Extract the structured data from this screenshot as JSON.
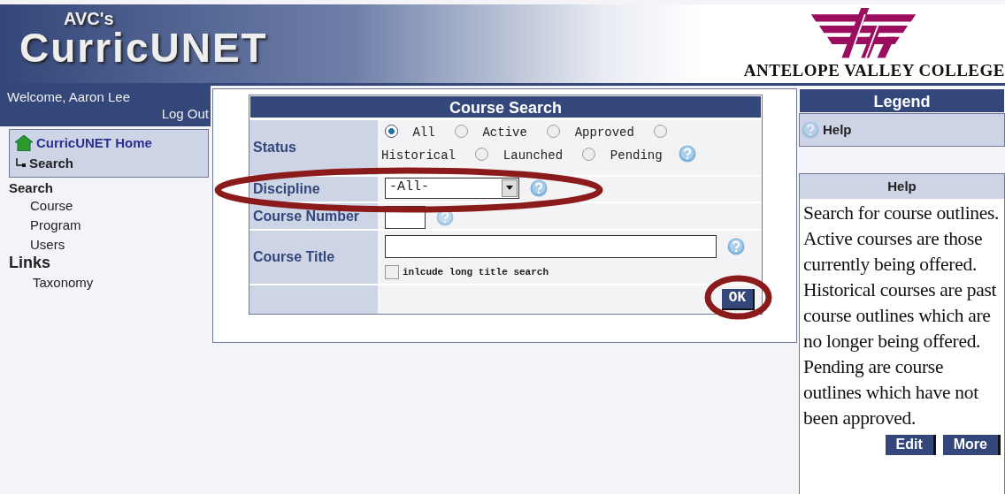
{
  "header": {
    "prefix": "AVC's",
    "title": "CurricUNET",
    "college": "ANTELOPE VALLEY COLLEGE"
  },
  "user": {
    "welcome": "Welcome, Aaron Lee",
    "logout": "Log Out"
  },
  "nav_box": {
    "home": "CurricUNET Home",
    "current": "Search"
  },
  "sidebar": [
    {
      "heading": "Search",
      "items": [
        "Course",
        "Program",
        "Users"
      ]
    },
    {
      "heading": "Links",
      "items": [
        "Taxonomy"
      ]
    }
  ],
  "form": {
    "title": "Course Search",
    "status": {
      "label": "Status",
      "circled": false,
      "options": [
        {
          "label": "All",
          "selected": true
        },
        {
          "label": "Active",
          "selected": false
        },
        {
          "label": "Approved",
          "selected": false
        },
        {
          "label": "Historical",
          "selected": false
        },
        {
          "label": "Launched",
          "selected": false
        },
        {
          "label": "Pending",
          "selected": false
        }
      ]
    },
    "discipline": {
      "label": "Discipline",
      "value": "-All-",
      "circled": true
    },
    "course_number": {
      "label": "Course Number",
      "circled": false
    },
    "course_title": {
      "label": "Course Title",
      "circled": false,
      "checkbox": {
        "label": "inlcude long title search",
        "checked": false
      }
    },
    "ok_button": {
      "label": "OK",
      "circled": true
    }
  },
  "legend": {
    "title": "Legend",
    "items": [
      "Help"
    ]
  },
  "help": {
    "title": "Help",
    "text": "Search for course outlines.  Active courses are those currently being offered.  Historical courses are past course outlines which are no longer being offered.  Pending are course outlines which have not been approved.",
    "buttons": [
      "Edit",
      "More"
    ]
  }
}
